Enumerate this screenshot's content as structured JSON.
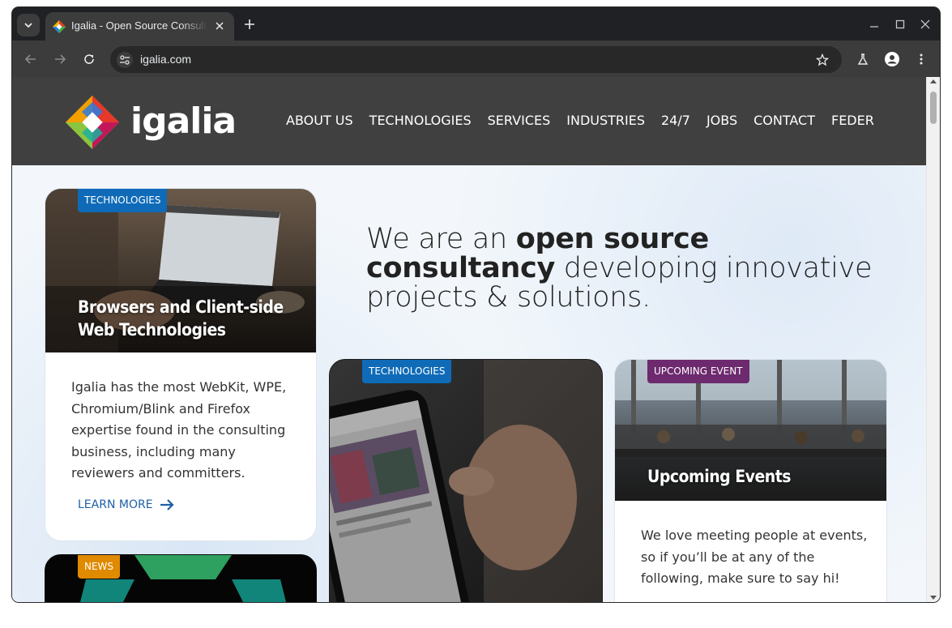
{
  "browser": {
    "tab": {
      "title": "Igalia - Open Source Consulting",
      "close_label": "×"
    },
    "url": "igalia.com"
  },
  "site": {
    "logo_text": "igalia",
    "nav": [
      "ABOUT US",
      "TECHNOLOGIES",
      "SERVICES",
      "INDUSTRIES",
      "24/7",
      "JOBS",
      "CONTACT",
      "FEDER"
    ],
    "hero": {
      "prefix": "We are an ",
      "bold": "open source consultancy",
      "suffix": " developing innovative projects & solutions."
    },
    "cards": [
      {
        "badge": "TECHNOLOGIES",
        "badge_color": "#0f6bb8",
        "title_line1": "Browsers and Client-side",
        "title_line2": "Web Technologies",
        "text": "Igalia has the most WebKit, WPE, Chromium/Blink and Firefox expertise found in the consulting business, including many reviewers and committers.",
        "link": "LEARN MORE"
      },
      {
        "badge": "TECHNOLOGIES",
        "badge_color": "#0f6bb8"
      },
      {
        "badge": "UPCOMING EVENT",
        "badge_color": "#6d2a6e",
        "title": "Upcoming Events",
        "text": "We love meeting people at events, so if you’ll be at any of the following, make sure to say hi!"
      },
      {
        "badge": "NEWS",
        "badge_color": "#e08a00"
      }
    ]
  }
}
